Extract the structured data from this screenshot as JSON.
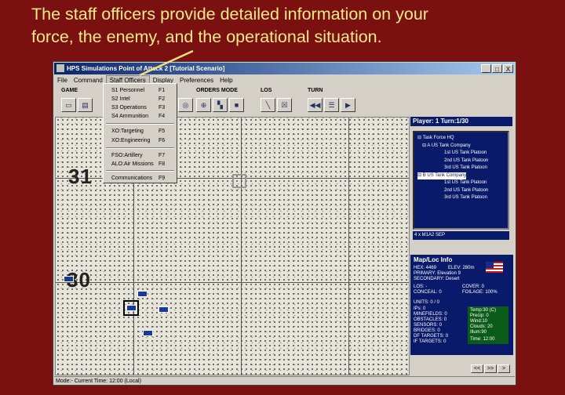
{
  "caption": {
    "line1": "The staff officers provide detailed information on your",
    "line2": "force, the enemy, and the operational situation."
  },
  "window": {
    "title": "HPS Simulations Point of Attack 2 [Tutorial Scenario]",
    "minimize": "_",
    "restore": "□",
    "close": "X"
  },
  "menubar": [
    "File",
    "Command",
    "Staff Officers",
    "Display",
    "Preferences",
    "Help"
  ],
  "toolbar": {
    "game_label": "GAME",
    "orders_label": "ORDERS MODE",
    "los_label": "LOS",
    "turn_label": "TURN"
  },
  "staff_menu": {
    "items": [
      {
        "label": "S1 Personnel",
        "key": "F1"
      },
      {
        "label": "S2 Intel",
        "key": "F2"
      },
      {
        "label": "S3 Operations",
        "key": "F3"
      },
      {
        "label": "S4 Ammunition",
        "key": "F4"
      },
      {
        "label": "XO:Targeting",
        "key": "F5"
      },
      {
        "label": "XO:Engineering",
        "key": "F6"
      },
      {
        "label": "FSO:Artillery",
        "key": "F7"
      },
      {
        "label": "ALO:Air Missions",
        "key": "F8"
      },
      {
        "label": "Communications",
        "key": "F9"
      }
    ]
  },
  "map": {
    "row_label_top": "31",
    "row_label_bottom": "30"
  },
  "sidebar": {
    "player_turn": "Player: 1   Turn:1/30",
    "tree": [
      {
        "label": "Task Force HQ",
        "prefix": "⊟"
      },
      {
        "label": "A US Tank Company",
        "prefix": "⊟"
      },
      {
        "label": "1st US Tank Platoon",
        "prefix": ""
      },
      {
        "label": "2nd US Tank Platoon",
        "prefix": ""
      },
      {
        "label": "3rd US Tank Platoon",
        "prefix": ""
      },
      {
        "label": "B US Tank Company",
        "prefix": "⊟"
      },
      {
        "label": "1st US Tank Platoon",
        "prefix": ""
      },
      {
        "label": "2nd US Tank Platoon",
        "prefix": ""
      },
      {
        "label": "3rd US Tank Platoon",
        "prefix": ""
      }
    ],
    "selected_unit": "4 x M1A2 SEP"
  },
  "mapinfo": {
    "title": "Map/Loc Info",
    "hex": "HEX: 4469",
    "elev": "ELEV:  280m",
    "primary": "PRIMARY: Elevation 9",
    "secondary": "SECONDARY: Desert",
    "los": "LOS: -",
    "cover": "COVER: 0",
    "conceal": "CONCEAL: 0",
    "foilage": "FOILAGE: 100%",
    "units": "UNITS: 0 / 0",
    "ips": "IPs: 0",
    "minefields": "MINEFIELDS: 0",
    "obstacles": "OBSTACLES: 0",
    "sensors": "SENSORS: 0",
    "bridges": "BRIDGES: 0",
    "df_targets": "DF TARGETS: 0",
    "if_targets": "IF TARGETS: 0"
  },
  "weather": {
    "temp": "Temp:30 (C)",
    "precip": "Precip: 0",
    "wind": "Wind:10",
    "clouds": "Clouds: 20",
    "illum": "Illum:90",
    "time": "Time: 12:00"
  },
  "nav": {
    "prev": "<<",
    "next": ">>",
    "end": ">"
  },
  "status": "Mode:- Current Time: 12:00 (Local)"
}
